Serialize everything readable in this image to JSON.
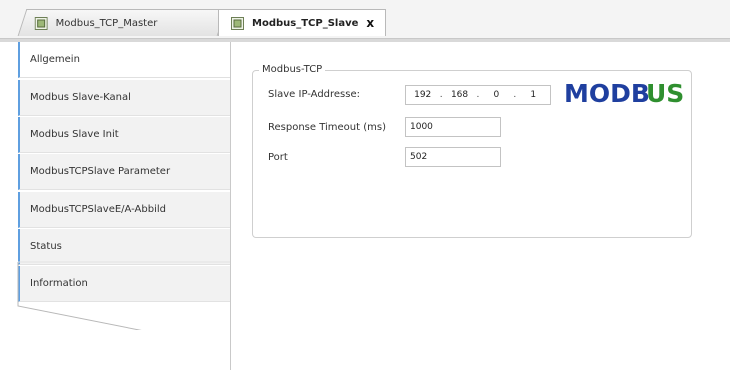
{
  "tabs": {
    "master_label": "Modbus_TCP_Master",
    "slave_label": "Modbus_TCP_Slave",
    "close_glyph": "x",
    "icon": "device-icon"
  },
  "sidebar": {
    "items": [
      {
        "label": "Allgemein",
        "active": true
      },
      {
        "label": "Modbus Slave-Kanal"
      },
      {
        "label": "Modbus Slave Init"
      },
      {
        "label": "ModbusTCPSlave Parameter"
      },
      {
        "label": "ModbusTCPSlaveE/A-Abbild"
      },
      {
        "label": "Status"
      },
      {
        "label": "Information"
      }
    ],
    "accent": "#5f9fe0"
  },
  "group": {
    "title": "Modbus-TCP",
    "ip_label": "Slave IP-Addresse:",
    "ip": [
      "192",
      "168",
      "0",
      "1"
    ],
    "ip_separator": ".",
    "timeout_label": "Response Timeout (ms)",
    "timeout_value": "1000",
    "port_label": "Port",
    "port_value": "502"
  },
  "logo": {
    "text_blue": "MODB",
    "text_green": "US",
    "blue": "#1f3f9f",
    "green": "#2f8f2f"
  }
}
